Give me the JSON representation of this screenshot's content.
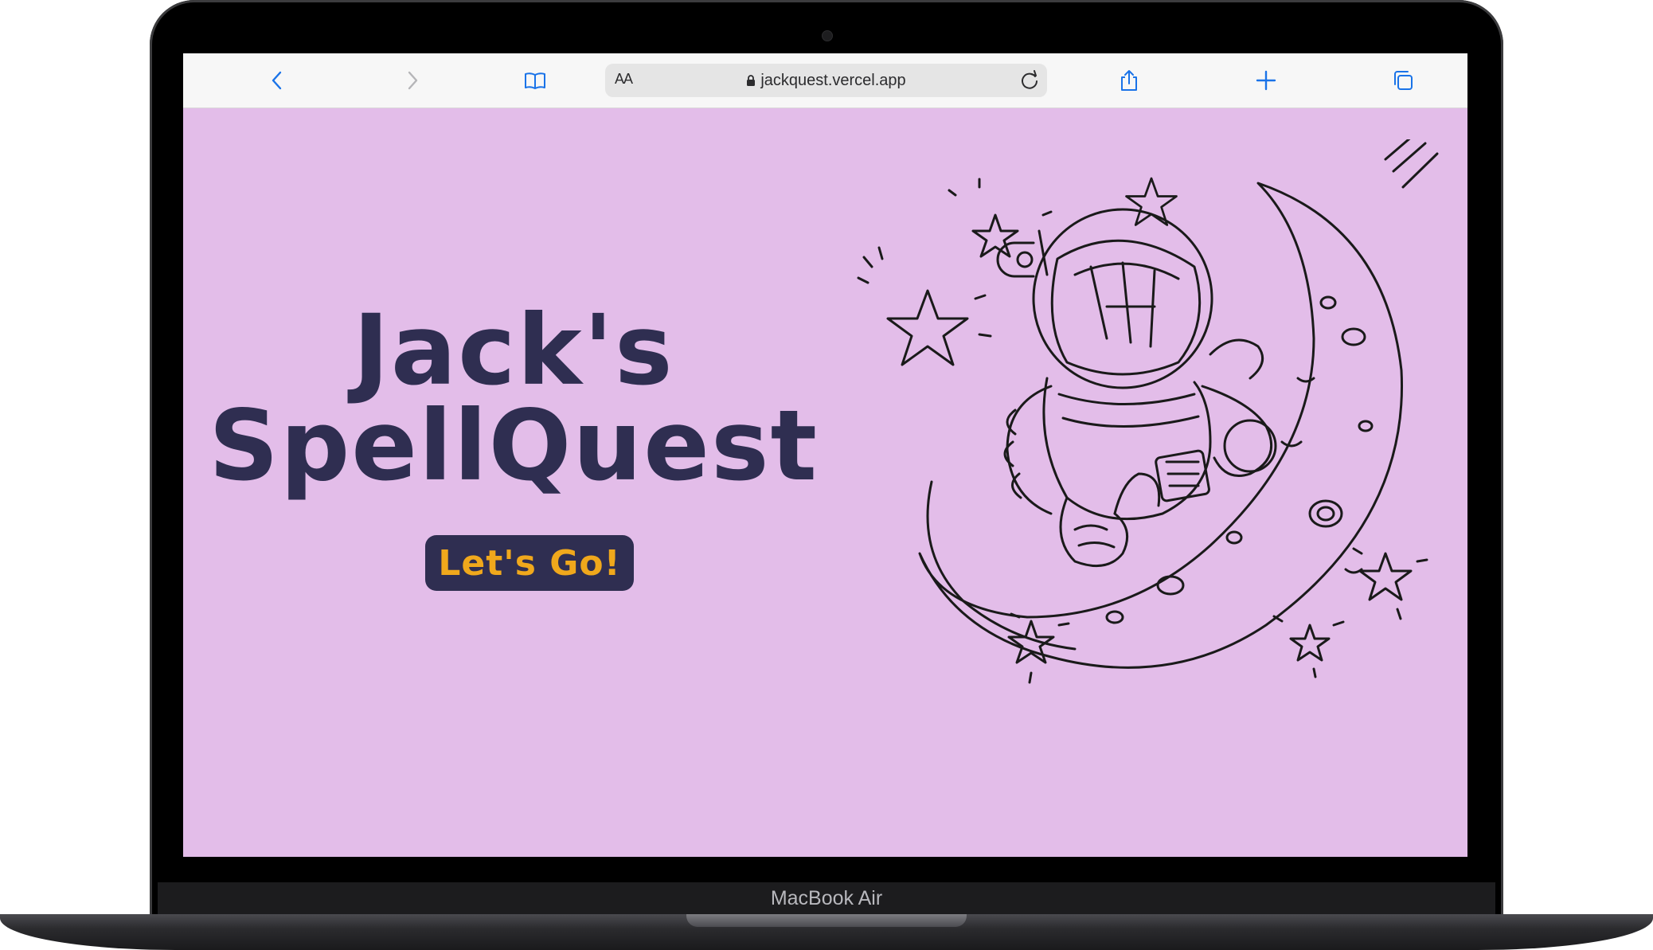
{
  "device": {
    "model_label": "MacBook Air"
  },
  "browser": {
    "toolbar": {
      "back_icon": "chevron-left-icon",
      "forward_icon": "chevron-right-icon",
      "bookmarks_icon": "book-icon",
      "text_size_label": "AA",
      "url": "jackquest.vercel.app",
      "lock_icon": "lock-icon",
      "reload_icon": "reload-icon",
      "share_icon": "share-icon",
      "new_tab_icon": "plus-icon",
      "tabs_icon": "tabs-icon",
      "accent_color": "#1a73e8"
    }
  },
  "page": {
    "background_color": "#e3bde9",
    "title_line_1": "Jack's",
    "title_line_2": "SpellQuest",
    "title_color": "#2f2e51",
    "cta_label": "Let's Go!",
    "cta_text_color": "#f0a81c",
    "illustration": "astronaut-on-moon-illustration"
  }
}
